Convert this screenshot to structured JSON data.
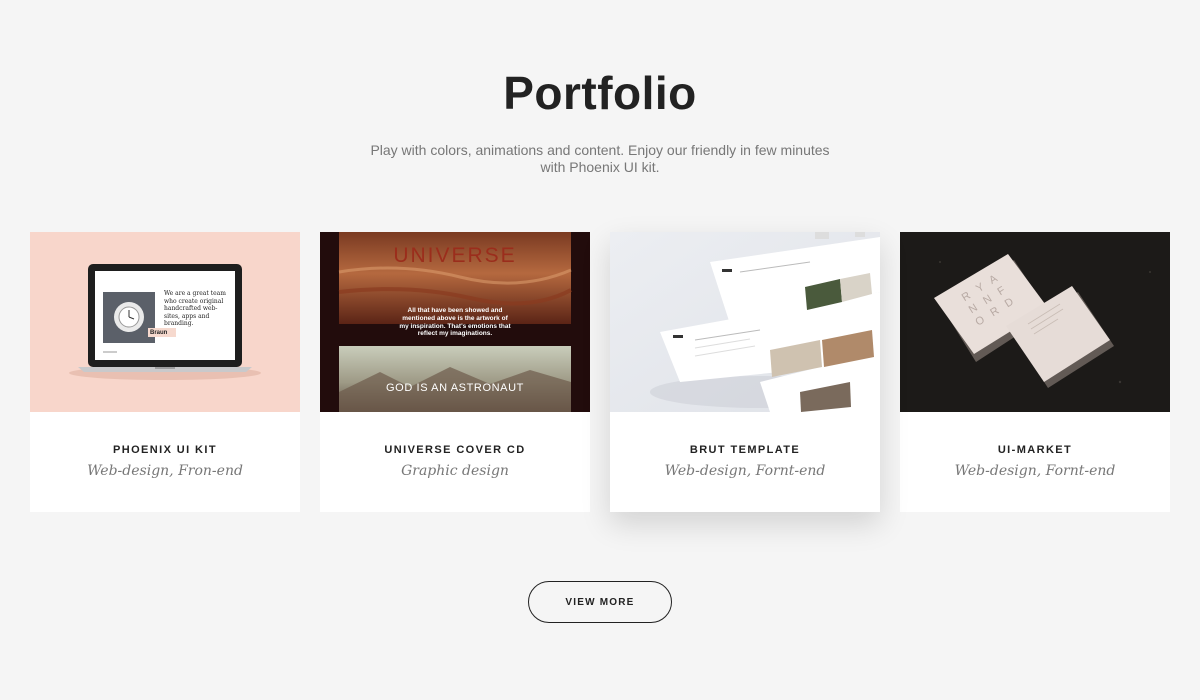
{
  "header": {
    "title": "Portfolio",
    "subtitle": "Play with colors, animations and content. Enjoy our friendly in few minutes with Phoenix UI kit."
  },
  "portfolio": {
    "items": [
      {
        "title": "PHOENIX UI KIT",
        "category": "Web-design, Fron-end",
        "image": {
          "screen_text": "We are a great team who create original handcrafted web-sites, apps and branding.",
          "brand_label": "Braun"
        }
      },
      {
        "title": "UNIVERSE COVER CD",
        "category": "Graphic design",
        "image": {
          "heading": "UNIVERSE",
          "quote_line_1": "All that have been showed and",
          "quote_line_2": "mentioned above is the artwork of",
          "quote_line_3": "my inspiration. That's emotions that",
          "quote_line_4": "reflect my imaginations.",
          "caption": "GOD IS AN ASTRONAUT"
        }
      },
      {
        "title": "BRUT TEMPLATE",
        "category": "Web-design, Fornt-end"
      },
      {
        "title": "UI-MARKET",
        "category": "Web-design, Fornt-end",
        "image": {
          "card_line_1": "R Y A",
          "card_line_2": "N N F",
          "card_line_3": "O R D"
        }
      }
    ]
  },
  "actions": {
    "view_more_label": "VIEW MORE"
  },
  "colors": {
    "background": "#f5f5f5",
    "card_bg": "#ffffff",
    "title_text": "#222222",
    "muted_text": "#777777",
    "peach": "#f8d6cb",
    "universe_red": "#9b2d1c"
  }
}
